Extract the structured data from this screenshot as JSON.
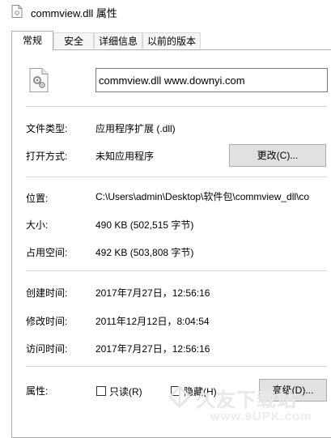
{
  "window": {
    "title": "commview.dll 属性"
  },
  "tabs": [
    {
      "label": "常规",
      "active": true
    },
    {
      "label": "安全",
      "active": false
    },
    {
      "label": "详细信息",
      "active": false
    },
    {
      "label": "以前的版本",
      "active": false
    }
  ],
  "file": {
    "name": "commview.dll www.downyi.com",
    "icon": "dll-gear-file-icon"
  },
  "rows": {
    "type": {
      "label": "文件类型:",
      "value": "应用程序扩展 (.dll)"
    },
    "opens_with": {
      "label": "打开方式:",
      "value": "未知应用程序",
      "button": "更改(C)..."
    },
    "location": {
      "label": "位置:",
      "value": "C:\\Users\\admin\\Desktop\\软件包\\commview_dll\\co"
    },
    "size": {
      "label": "大小:",
      "value": "490 KB (502,515 字节)"
    },
    "size_on_disk": {
      "label": "占用空间:",
      "value": "492 KB (503,808 字节)"
    },
    "created": {
      "label": "创建时间:",
      "value": "2017年7月27日，12:56:16"
    },
    "modified": {
      "label": "修改时间:",
      "value": "2011年12月12日，8:04:54"
    },
    "accessed": {
      "label": "访问时间:",
      "value": "2017年7月27日，12:56:16"
    }
  },
  "attributes": {
    "label": "属性:",
    "readonly": {
      "label": "只读(R)",
      "checked": false
    },
    "hidden": {
      "label": "隐藏(H)",
      "checked": false
    },
    "advanced_button": "高级(D)..."
  },
  "watermark": {
    "text": "久友下载站",
    "url": "www.9UPK.com"
  }
}
